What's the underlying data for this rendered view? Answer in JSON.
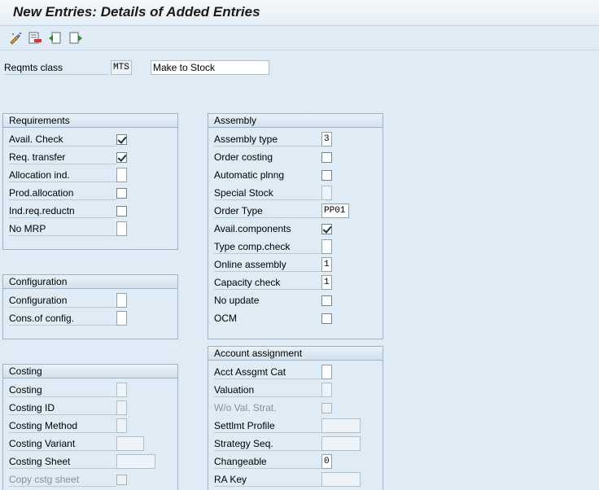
{
  "window": {
    "title": "New Entries: Details of Added Entries"
  },
  "toolbar": {
    "icons": [
      "display-change-icon",
      "delete-icon",
      "previous-entry-icon",
      "next-entry-icon"
    ]
  },
  "header": {
    "reqmts_class_label": "Reqmts class",
    "reqmts_class_value": "MTS",
    "reqmts_class_desc": "Make to Stock"
  },
  "requirements": {
    "title": "Requirements",
    "avail_check": "Avail. Check",
    "req_transfer": "Req. transfer",
    "allocation_ind": "Allocation ind.",
    "prod_allocation": "Prod.allocation",
    "ind_req_reductn": "Ind.req.reductn",
    "no_mrp": "No MRP"
  },
  "configuration": {
    "title": "Configuration",
    "configuration": "Configuration",
    "cons_of_config": "Cons.of config."
  },
  "costing": {
    "title": "Costing",
    "costing": "Costing",
    "costing_id": "Costing ID",
    "costing_method": "Costing Method",
    "costing_variant": "Costing Variant",
    "costing_sheet": "Costing Sheet",
    "copy_cstg_sheet": "Copy cstg sheet"
  },
  "assembly": {
    "title": "Assembly",
    "assembly_type": "Assembly type",
    "assembly_type_value": "3",
    "order_costing": "Order costing",
    "automatic_plnng": "Automatic plnng",
    "special_stock": "Special Stock",
    "order_type": "Order Type",
    "order_type_value": "PP01",
    "avail_components": "Avail.components",
    "type_comp_check": "Type comp.check",
    "online_assembly": "Online assembly",
    "online_assembly_value": "1",
    "capacity_check": "Capacity check",
    "capacity_check_value": "1",
    "no_update": "No update",
    "ocm": "OCM"
  },
  "account_assignment": {
    "title": "Account assignment",
    "acct_assgmt_cat": "Acct Assgmt Cat",
    "valuation": "Valuation",
    "wo_val_strat": "W/o Val. Strat.",
    "settlmt_profile": "Settlmt Profile",
    "strategy_seq": "Strategy Seq.",
    "changeable": "Changeable",
    "changeable_value": "0",
    "ra_key": "RA Key"
  }
}
